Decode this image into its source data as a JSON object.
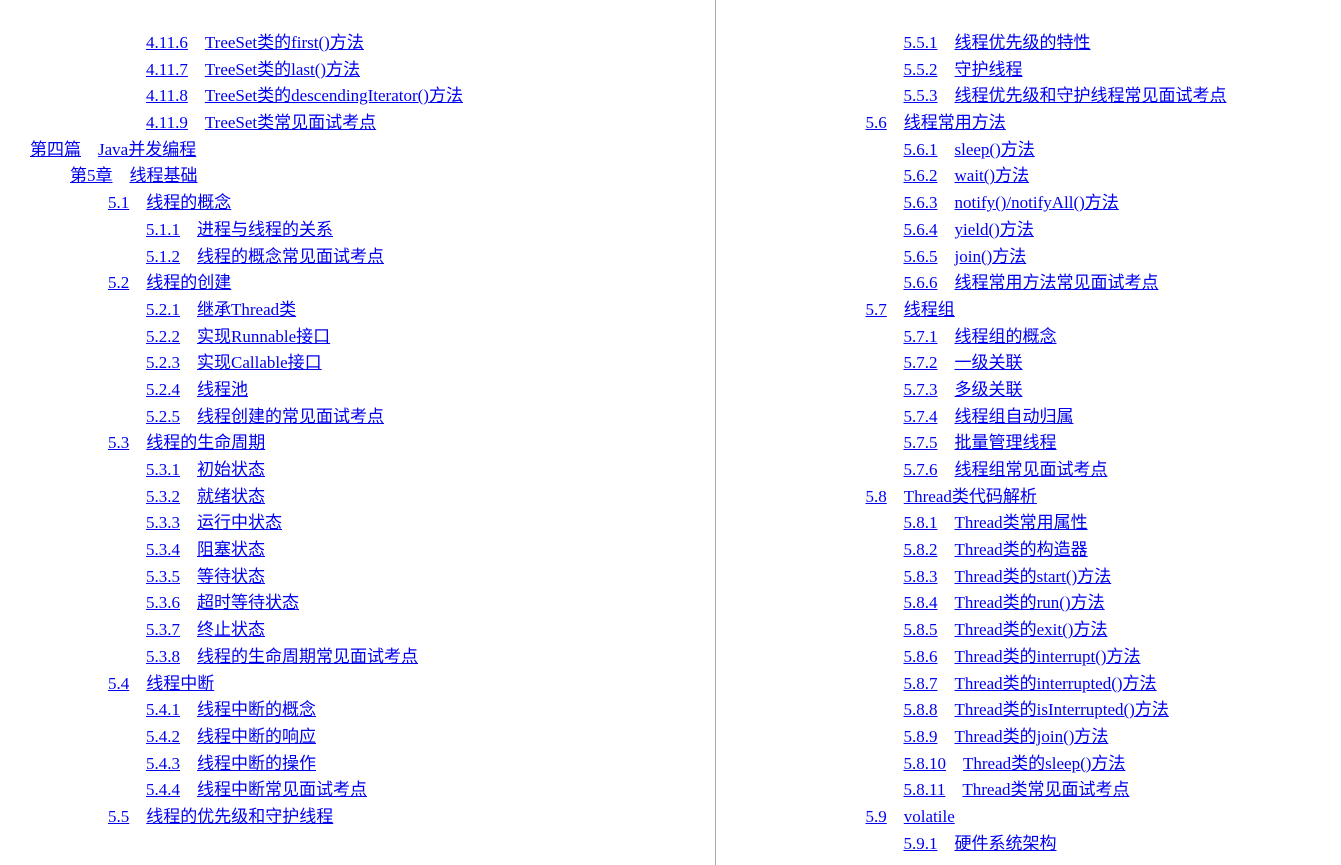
{
  "leftPage": {
    "entries": [
      {
        "level": 3,
        "num": "4.11.6",
        "title": "TreeSet类的first()方法"
      },
      {
        "level": 3,
        "num": "4.11.7",
        "title": "TreeSet类的last()方法"
      },
      {
        "level": 3,
        "num": "4.11.8",
        "title": "TreeSet类的descendingIterator()方法"
      },
      {
        "level": 3,
        "num": "4.11.9",
        "title": "TreeSet类常见面试考点"
      },
      {
        "level": 0,
        "num": "第四篇",
        "title": "Java并发编程"
      },
      {
        "level": 1,
        "num": "第5章",
        "title": "线程基础"
      },
      {
        "level": 2,
        "num": "5.1",
        "title": "线程的概念"
      },
      {
        "level": 3,
        "num": "5.1.1",
        "title": "进程与线程的关系"
      },
      {
        "level": 3,
        "num": "5.1.2",
        "title": "线程的概念常见面试考点"
      },
      {
        "level": 2,
        "num": "5.2",
        "title": "线程的创建"
      },
      {
        "level": 3,
        "num": "5.2.1",
        "title": "继承Thread类"
      },
      {
        "level": 3,
        "num": "5.2.2",
        "title": "实现Runnable接口"
      },
      {
        "level": 3,
        "num": "5.2.3",
        "title": "实现Callable接口"
      },
      {
        "level": 3,
        "num": "5.2.4",
        "title": "线程池"
      },
      {
        "level": 3,
        "num": "5.2.5",
        "title": "线程创建的常见面试考点"
      },
      {
        "level": 2,
        "num": "5.3",
        "title": "线程的生命周期"
      },
      {
        "level": 3,
        "num": "5.3.1",
        "title": "初始状态"
      },
      {
        "level": 3,
        "num": "5.3.2",
        "title": "就绪状态"
      },
      {
        "level": 3,
        "num": "5.3.3",
        "title": "运行中状态"
      },
      {
        "level": 3,
        "num": "5.3.4",
        "title": "阻塞状态"
      },
      {
        "level": 3,
        "num": "5.3.5",
        "title": "等待状态"
      },
      {
        "level": 3,
        "num": "5.3.6",
        "title": "超时等待状态"
      },
      {
        "level": 3,
        "num": "5.3.7",
        "title": "终止状态"
      },
      {
        "level": 3,
        "num": "5.3.8",
        "title": "线程的生命周期常见面试考点"
      },
      {
        "level": 2,
        "num": "5.4",
        "title": "线程中断"
      },
      {
        "level": 3,
        "num": "5.4.1",
        "title": "线程中断的概念"
      },
      {
        "level": 3,
        "num": "5.4.2",
        "title": "线程中断的响应"
      },
      {
        "level": 3,
        "num": "5.4.3",
        "title": "线程中断的操作"
      },
      {
        "level": 3,
        "num": "5.4.4",
        "title": "线程中断常见面试考点"
      },
      {
        "level": 2,
        "num": "5.5",
        "title": "线程的优先级和守护线程"
      }
    ]
  },
  "rightPage": {
    "entries": [
      {
        "level": 3,
        "num": "5.5.1",
        "title": "线程优先级的特性"
      },
      {
        "level": 3,
        "num": "5.5.2",
        "title": "守护线程"
      },
      {
        "level": 3,
        "num": "5.5.3",
        "title": "线程优先级和守护线程常见面试考点"
      },
      {
        "level": 2,
        "num": "5.6",
        "title": "线程常用方法"
      },
      {
        "level": 3,
        "num": "5.6.1",
        "title": "sleep()方法"
      },
      {
        "level": 3,
        "num": "5.6.2",
        "title": "wait()方法"
      },
      {
        "level": 3,
        "num": "5.6.3",
        "title": "notify()/notifyAll()方法"
      },
      {
        "level": 3,
        "num": "5.6.4",
        "title": "yield()方法"
      },
      {
        "level": 3,
        "num": "5.6.5",
        "title": "join()方法"
      },
      {
        "level": 3,
        "num": "5.6.6",
        "title": "线程常用方法常见面试考点"
      },
      {
        "level": 2,
        "num": "5.7",
        "title": "线程组"
      },
      {
        "level": 3,
        "num": "5.7.1",
        "title": "线程组的概念"
      },
      {
        "level": 3,
        "num": "5.7.2",
        "title": "一级关联"
      },
      {
        "level": 3,
        "num": "5.7.3",
        "title": "多级关联"
      },
      {
        "level": 3,
        "num": "5.7.4",
        "title": "线程组自动归属"
      },
      {
        "level": 3,
        "num": "5.7.5",
        "title": "批量管理线程"
      },
      {
        "level": 3,
        "num": "5.7.6",
        "title": "线程组常见面试考点"
      },
      {
        "level": 2,
        "num": "5.8",
        "title": "Thread类代码解析"
      },
      {
        "level": 3,
        "num": "5.8.1",
        "title": "Thread类常用属性"
      },
      {
        "level": 3,
        "num": "5.8.2",
        "title": "Thread类的构造器"
      },
      {
        "level": 3,
        "num": "5.8.3",
        "title": "Thread类的start()方法"
      },
      {
        "level": 3,
        "num": "5.8.4",
        "title": "Thread类的run()方法"
      },
      {
        "level": 3,
        "num": "5.8.5",
        "title": "Thread类的exit()方法"
      },
      {
        "level": 3,
        "num": "5.8.6",
        "title": "Thread类的interrupt()方法"
      },
      {
        "level": 3,
        "num": "5.8.7",
        "title": "Thread类的interrupted()方法"
      },
      {
        "level": 3,
        "num": "5.8.8",
        "title": "Thread类的isInterrupted()方法"
      },
      {
        "level": 3,
        "num": "5.8.9",
        "title": "Thread类的join()方法"
      },
      {
        "level": 3,
        "num": "5.8.10",
        "title": "Thread类的sleep()方法"
      },
      {
        "level": 3,
        "num": "5.8.11",
        "title": "Thread类常见面试考点"
      },
      {
        "level": 2,
        "num": "5.9",
        "title": "volatile"
      },
      {
        "level": 3,
        "num": "5.9.1",
        "title": "硬件系统架构"
      }
    ]
  }
}
